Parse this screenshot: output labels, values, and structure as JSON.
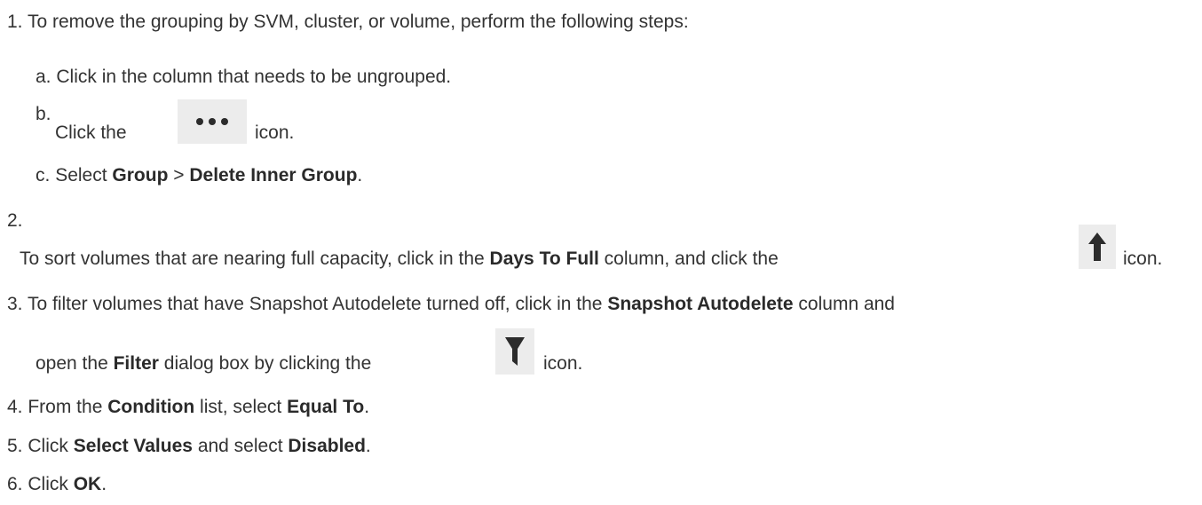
{
  "steps": [
    {
      "number": "1.",
      "text": "To remove the grouping by SVM, cluster, or volume, perform the following steps:",
      "substeps": [
        {
          "letter": "a.",
          "text": "Click in the column that needs to be ungrouped."
        },
        {
          "letter": "b.",
          "text_before": "Click the",
          "icon": "more-options-icon",
          "text_after": "icon."
        },
        {
          "letter": "c.",
          "text_before": "Select",
          "bold_1": "Group",
          "sep": ">",
          "bold_2": "Delete Inner Group",
          "text_after": "."
        }
      ]
    },
    {
      "number": "2.",
      "text_before": "To sort volumes that are nearing full capacity, click in the",
      "bold_1": "Days To Full",
      "text_mid": "column, and click the",
      "icon": "sort-up-arrow-icon",
      "text_after": "icon."
    },
    {
      "number": "3.",
      "line1_before": "To filter volumes that have Snapshot Autodelete turned off, click in the",
      "line1_bold": "Snapshot Autodelete",
      "line1_after": "column and",
      "line2_before": "open the",
      "line2_bold": "Filter",
      "line2_mid": "dialog box by clicking the",
      "icon": "filter-icon",
      "line2_after": "icon."
    },
    {
      "number": "4.",
      "text_before": "From the",
      "bold_1": "Condition",
      "text_mid": "list, select",
      "bold_2": "Equal To",
      "text_after": "."
    },
    {
      "number": "5.",
      "text_before": "Click",
      "bold_1": "Select Values",
      "text_mid": "and select",
      "bold_2": "Disabled",
      "text_after": "."
    },
    {
      "number": "6.",
      "text_before": "Click",
      "bold_1": "OK",
      "text_after": "."
    }
  ],
  "colors": {
    "text": "#333333",
    "icon_bg": "#ececec",
    "icon_fg": "#2b2b2b"
  }
}
